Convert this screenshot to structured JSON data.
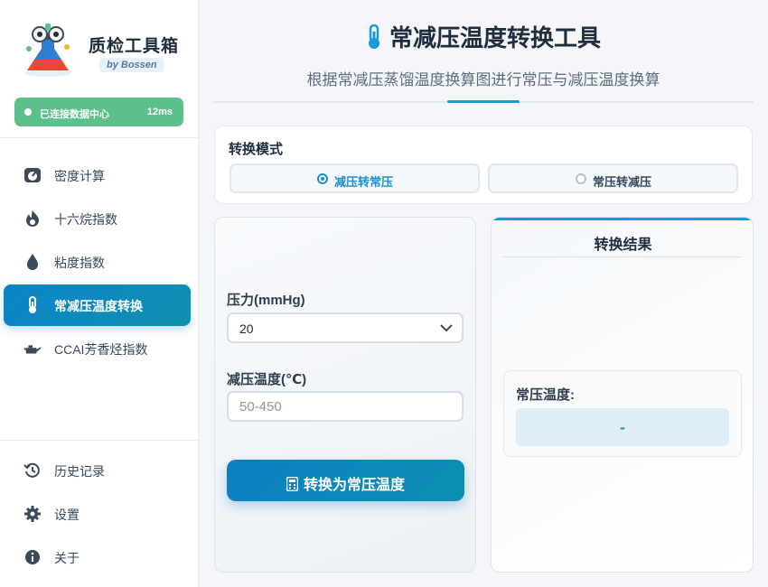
{
  "sidebar": {
    "brand_title": "质检工具箱",
    "brand_sub": "by Bossen",
    "status": {
      "text": "已连接数据中心",
      "latency": "12ms",
      "color": "#5cc08a"
    },
    "items": [
      {
        "label": "密度计算",
        "icon": "gauge-icon"
      },
      {
        "label": "十六烷指数",
        "icon": "fire-icon"
      },
      {
        "label": "粘度指数",
        "icon": "droplet-icon"
      },
      {
        "label": "常减压温度转换",
        "icon": "thermometer-icon",
        "active": true
      },
      {
        "label": "CCAI芳香烃指数",
        "icon": "oil-can-icon"
      }
    ],
    "bottom_items": [
      {
        "label": "历史记录",
        "icon": "history-icon"
      },
      {
        "label": "设置",
        "icon": "gear-icon"
      },
      {
        "label": "关于",
        "icon": "info-icon"
      }
    ]
  },
  "main": {
    "title": "常减压温度转换工具",
    "subtitle": "根据常减压蒸馏温度换算图进行常压与减压温度换算",
    "accent_color": "#1a9ad6",
    "mode": {
      "title": "转换模式",
      "options": [
        {
          "label": "减压转常压",
          "selected": true
        },
        {
          "label": "常压转减压",
          "selected": false
        }
      ]
    },
    "form": {
      "pressure_label": "压力(mmHg)",
      "pressure_value": "20",
      "temp_label": "减压温度(℃)",
      "temp_value": "",
      "temp_placeholder": "50-450",
      "button_label": "转换为常压温度"
    },
    "result": {
      "title": "转换结果",
      "label": "常压温度:",
      "value": "-"
    }
  }
}
